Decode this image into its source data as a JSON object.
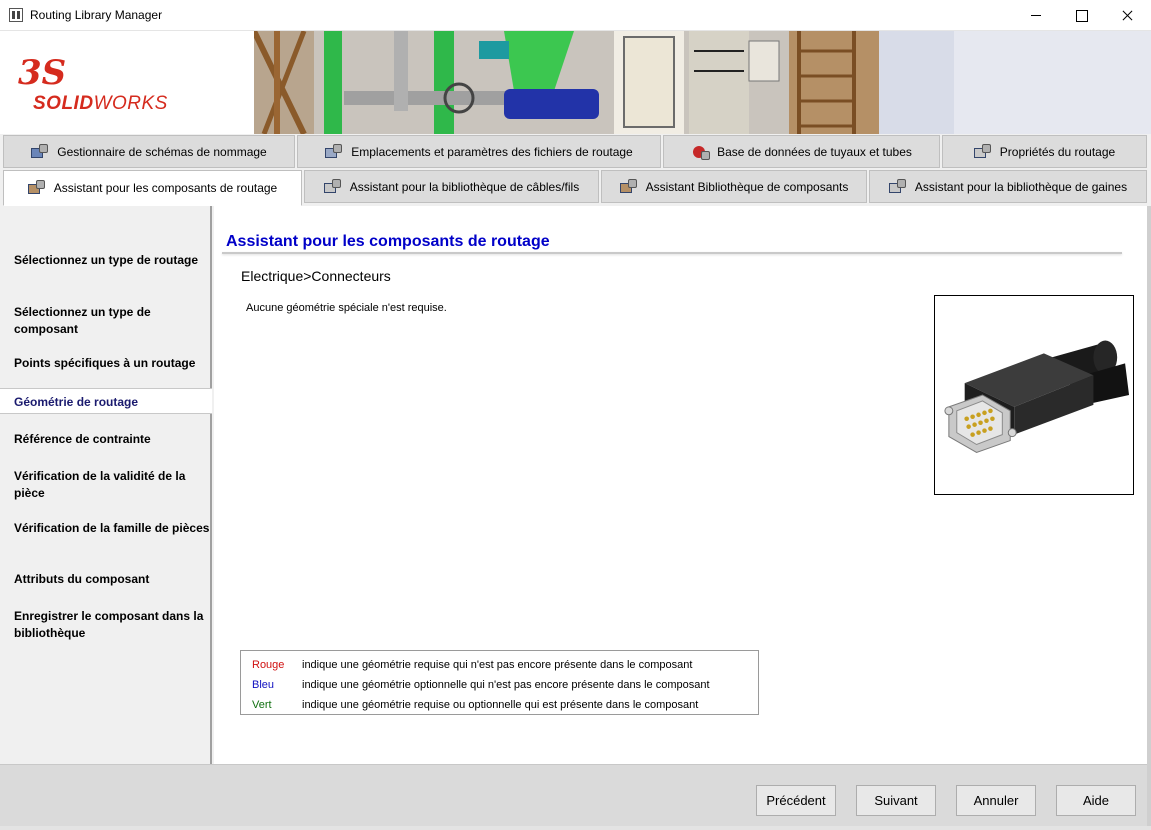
{
  "window": {
    "title": "Routing Library Manager",
    "icon": "app-icon"
  },
  "banner": {
    "logo_ds": "3S",
    "logo_solid": "SOLID",
    "logo_works": "WORKS",
    "brand_color": "#d52b1e"
  },
  "tabs_row1": [
    {
      "label": "Gestionnaire de schémas de nommage",
      "icon": "naming-schema-icon"
    },
    {
      "label": "Emplacements et paramètres des fichiers de routage",
      "icon": "file-locations-icon"
    },
    {
      "label": "Base de données de tuyaux et tubes",
      "icon": "pipe-database-icon"
    },
    {
      "label": "Propriétés du routage",
      "icon": "routing-properties-icon"
    }
  ],
  "tabs_row2": [
    {
      "label": "Assistant pour les composants de routage",
      "icon": "component-wizard-icon",
      "active": true
    },
    {
      "label": "Assistant pour la bibliothèque de câbles/fils",
      "icon": "cable-library-icon"
    },
    {
      "label": "Assistant Bibliothèque de composants",
      "icon": "component-library-icon"
    },
    {
      "label": "Assistant pour la bibliothèque de gaines",
      "icon": "sheath-library-icon"
    }
  ],
  "nav": {
    "items": [
      "Sélectionnez un type de routage",
      "Sélectionnez un type de composant",
      "Points spécifiques à un routage",
      "Géométrie de routage",
      "Référence de contrainte",
      "Vérification de la validité de la pièce",
      "Vérification de la famille de pièces",
      "Attributs du composant",
      "Enregistrer le composant dans la bibliothèque"
    ],
    "active_index": 3
  },
  "main": {
    "title": "Assistant pour les composants de routage",
    "title_color": "#0000c8",
    "breadcrumb": "Electrique>Connecteurs",
    "note": "Aucune géométrie spéciale n'est requise.",
    "preview_icon": "d-sub-connector-icon"
  },
  "legend": [
    {
      "label": "Rouge",
      "color": "#d01010",
      "desc": "indique une géométrie requise qui n'est pas encore présente dans le composant"
    },
    {
      "label": "Bleu",
      "color": "#1010c0",
      "desc": "indique une géométrie optionnelle qui n'est pas encore présente dans le composant"
    },
    {
      "label": "Vert",
      "color": "#107010",
      "desc": "indique une géométrie requise ou optionnelle qui est présente dans le composant"
    }
  ],
  "buttons": {
    "previous": "Précédent",
    "next": "Suivant",
    "cancel": "Annuler",
    "help": "Aide"
  }
}
